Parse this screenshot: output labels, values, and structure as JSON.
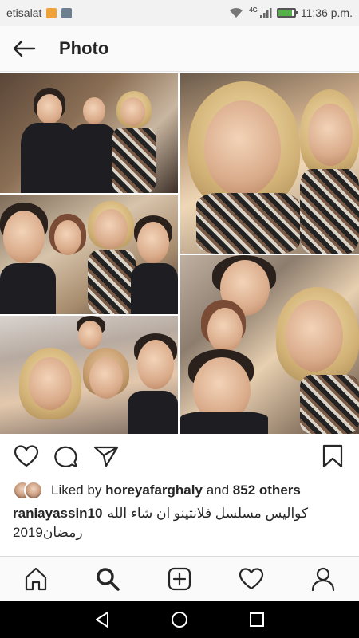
{
  "status_bar": {
    "carrier": "etisalat",
    "network_type": "4G",
    "time": "11:36 p.m.",
    "battery_level": 0.85,
    "icons": [
      "notification-icon",
      "gallery-icon",
      "wifi-icon",
      "signal-icon",
      "battery-icon"
    ]
  },
  "header": {
    "back_icon": "arrow-left-icon",
    "title": "Photo"
  },
  "post": {
    "photo_icon": "collage-photo",
    "actions": [
      "heart-icon",
      "comment-icon",
      "share-icon",
      "bookmark-icon"
    ],
    "liked_by_prefix": "Liked by",
    "liked_by_user": "horeyafarghaly",
    "liked_by_and": "and",
    "liked_by_others": "852 others",
    "caption_user": "raniayassin10",
    "caption_line1": "كواليس مسلسل فلانتينو ان شاء الله",
    "caption_line2": "2019رمضان"
  },
  "bottom_nav": {
    "items": [
      "home-icon",
      "search-icon",
      "new-post-icon",
      "activity-heart-icon",
      "profile-icon"
    ],
    "active": "search-icon"
  },
  "system_nav": {
    "items": [
      "back-triangle-icon",
      "home-circle-icon",
      "recents-square-icon"
    ]
  },
  "colors": {
    "text": "#262626",
    "battery_green": "#55b04a",
    "nav_background": "#fafafa",
    "system_nav_background": "#000000"
  }
}
